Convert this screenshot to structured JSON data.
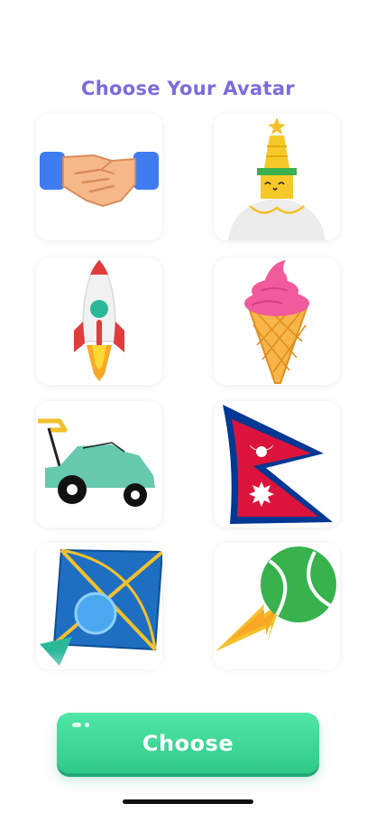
{
  "header": {
    "title": "Choose Your Avatar"
  },
  "avatars": [
    {
      "name": "handshake-icon"
    },
    {
      "name": "stupa-icon"
    },
    {
      "name": "rocket-icon"
    },
    {
      "name": "ice-cream-icon"
    },
    {
      "name": "lawn-mower-icon"
    },
    {
      "name": "nepal-flag-icon"
    },
    {
      "name": "kite-icon"
    },
    {
      "name": "tennis-ball-icon"
    },
    {
      "name": "partial-avatar"
    }
  ],
  "footer": {
    "choose_label": "Choose"
  },
  "colors": {
    "title": "#7a6cdc",
    "button": "#3ad896",
    "nepal_red": "#dc143c",
    "nepal_blue": "#003893"
  }
}
